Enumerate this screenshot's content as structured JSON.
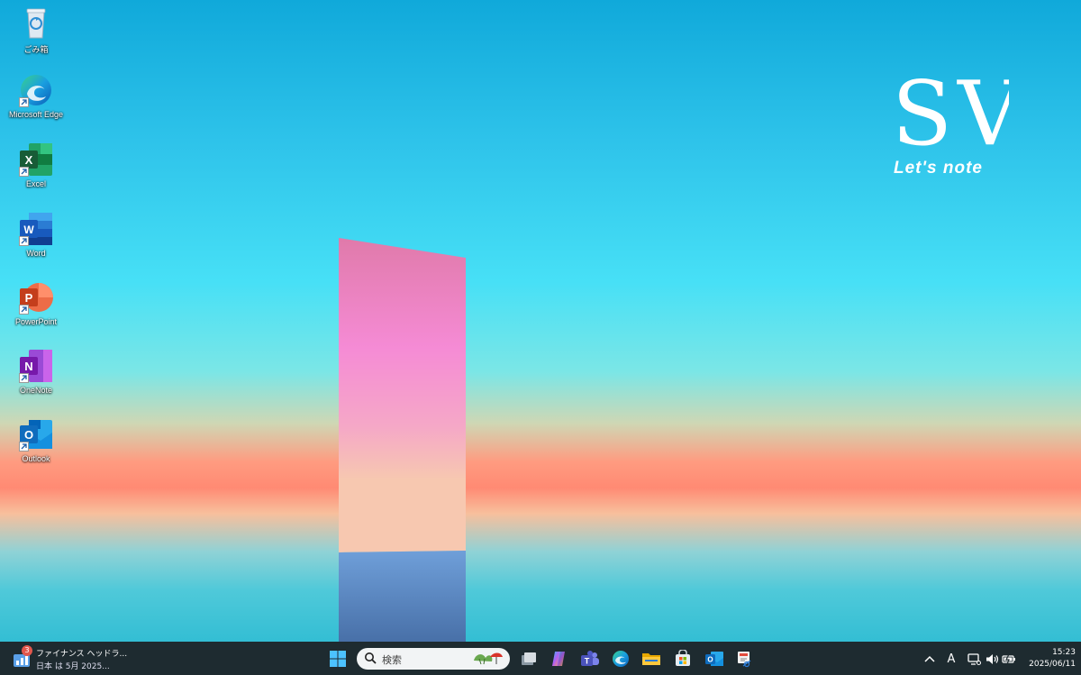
{
  "desktop": {
    "icons": [
      {
        "label": "ごみ箱",
        "icon": "recycle-bin-icon"
      },
      {
        "label": "Microsoft Edge",
        "icon": "edge-icon"
      },
      {
        "label": "Excel",
        "icon": "excel-icon"
      },
      {
        "label": "Word",
        "icon": "word-icon"
      },
      {
        "label": "PowerPoint",
        "icon": "powerpoint-icon"
      },
      {
        "label": "OneNote",
        "icon": "onenote-icon"
      },
      {
        "label": "Outlook",
        "icon": "outlook-icon"
      }
    ],
    "brand": {
      "model": "SV",
      "name": "Let's note"
    }
  },
  "taskbar": {
    "widget": {
      "badge": "3",
      "title": "ファイナンス ヘッドラ...",
      "subtitle": "日本 は 5月 2025..."
    },
    "search": {
      "placeholder": "検索"
    },
    "pinned": [
      "task-view-icon",
      "copilot-icon",
      "teams-icon",
      "edge-icon",
      "file-explorer-icon",
      "store-icon",
      "outlook-icon",
      "snipping-tool-icon"
    ],
    "tray": {
      "ime": "A"
    },
    "clock": {
      "time": "15:23",
      "date": "2025/06/11"
    }
  },
  "colors": {
    "taskbar": "#1e2b30",
    "accent": "#0078d4"
  }
}
